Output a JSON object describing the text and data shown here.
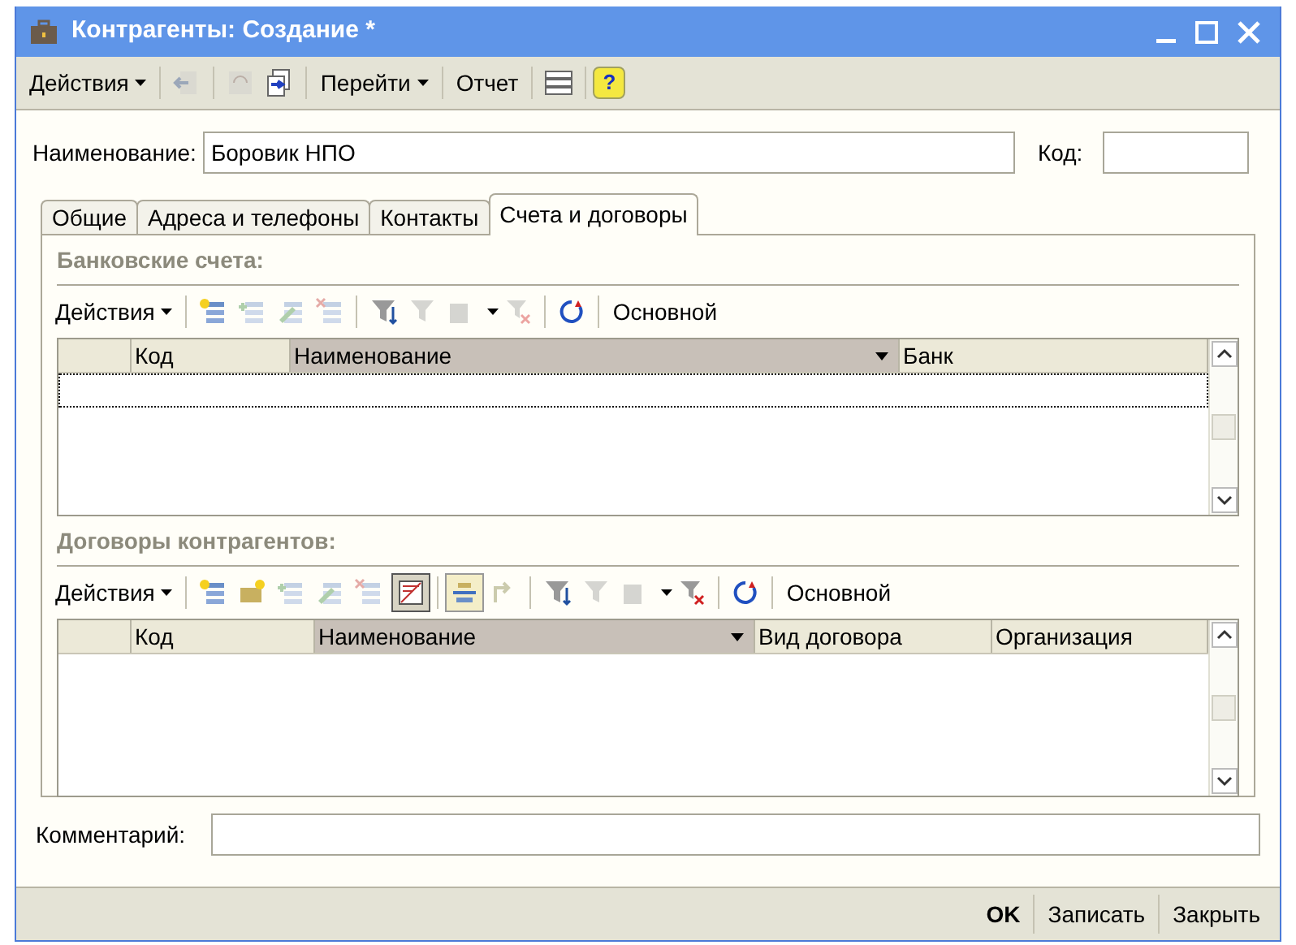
{
  "window": {
    "title": "Контрагенты: Создание *"
  },
  "toolbar": {
    "actions": "Действия",
    "goto": "Перейти",
    "report": "Отчет",
    "help": "?"
  },
  "name_field": {
    "label": "Наименование:",
    "value": "Боровик НПО"
  },
  "code_field": {
    "label": "Код:"
  },
  "tabs": [
    {
      "label": "Общие",
      "selected": false
    },
    {
      "label": "Адреса и телефоны",
      "selected": false
    },
    {
      "label": "Контакты",
      "selected": false
    },
    {
      "label": "Счета и договоры",
      "selected": true
    }
  ],
  "bank_accounts": {
    "title": "Банковские счета:",
    "actions": "Действия",
    "main_label": "Основной",
    "columns": [
      {
        "label": "Код",
        "sorted": false
      },
      {
        "label": "Наименование",
        "sorted": true
      },
      {
        "label": "Банк",
        "sorted": false
      }
    ]
  },
  "contracts": {
    "title": "Договоры контрагентов:",
    "actions": "Действия",
    "main_label": "Основной",
    "columns": [
      {
        "label": "Код",
        "sorted": false
      },
      {
        "label": "Наименование",
        "sorted": true
      },
      {
        "label": "Вид договора",
        "sorted": false
      },
      {
        "label": "Организация",
        "sorted": false
      }
    ]
  },
  "comment_field": {
    "label": "Комментарий:"
  },
  "buttons": [
    {
      "label": "OK",
      "kind": "default"
    },
    {
      "label": "Записать",
      "kind": "normal"
    },
    {
      "label": "Закрыть",
      "kind": "normal"
    }
  ]
}
